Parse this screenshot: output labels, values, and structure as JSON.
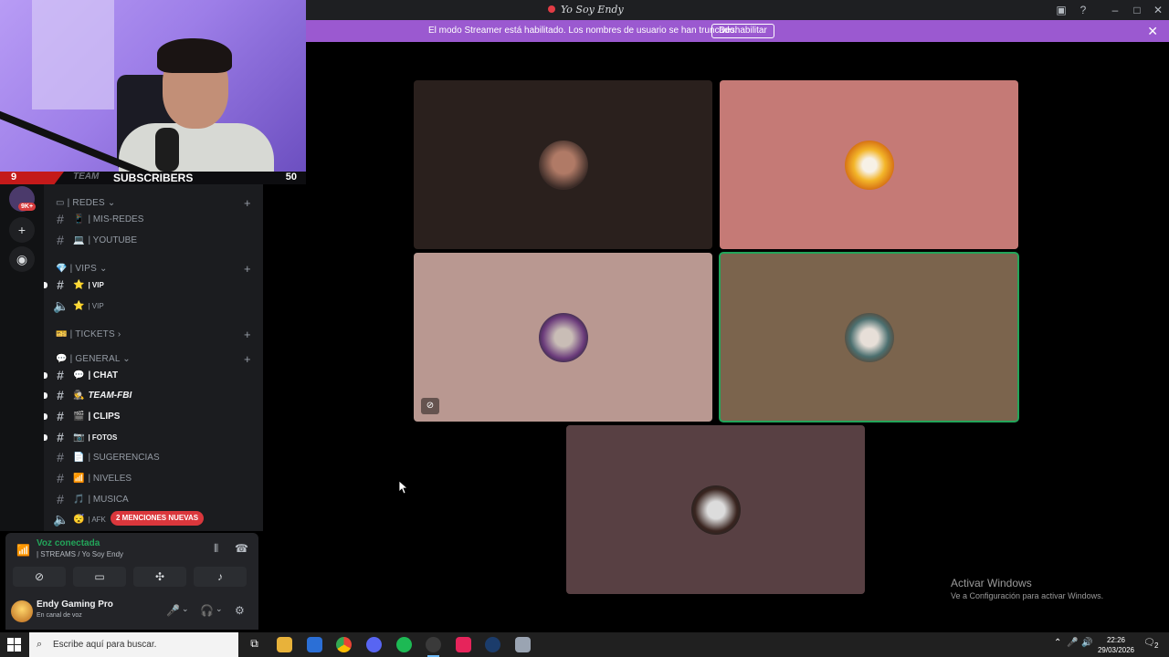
{
  "window": {
    "title": "Yo Soy Endy"
  },
  "banner": {
    "message": "El modo Streamer está habilitado. Los nombres de usuario se han truncado.",
    "button": "Deshabilitar"
  },
  "overlay": {
    "left_count": "9",
    "label": "SUBSCRIBERS",
    "right_count": "50",
    "behind_text": "TEAM"
  },
  "rail": {
    "badge": "9K+",
    "icons": [
      "server-avatar-icon",
      "add-server-icon",
      "explore-icon"
    ]
  },
  "channels": {
    "categories": [
      {
        "label": "| REDES",
        "expand": "⌄"
      },
      {
        "label": "| VIPS",
        "expand": "⌄"
      },
      {
        "label": "| TICKETS",
        "expand": "›"
      },
      {
        "label": "| GENERAL",
        "expand": "⌄"
      }
    ],
    "items": [
      {
        "label": "| MIS-REDES"
      },
      {
        "label": "| YOUTUBE"
      },
      {
        "label": "| VIP"
      },
      {
        "label": "| VIP"
      },
      {
        "label": "| CHAT"
      },
      {
        "label": "TEAM-FBI"
      },
      {
        "label": "| CLIPS"
      },
      {
        "label": "| FOTOS"
      },
      {
        "label": "| SUGERENCIAS"
      },
      {
        "label": "| NIVELES"
      },
      {
        "label": "| MUSICA"
      },
      {
        "label": "| AFK"
      }
    ],
    "mentions_pill": "2 MENCIONES NUEVAS"
  },
  "voice": {
    "status": "Voz conectada",
    "channel": "| STREAMS / Yo Soy Endy"
  },
  "user": {
    "name": "Endy Gaming Pro",
    "status": "En canal de voz"
  },
  "tiles": [
    {
      "bg": "#2a201d",
      "speaking": false
    },
    {
      "bg": "#c57a76",
      "speaking": false
    },
    {
      "bg": "#b99891",
      "speaking": false,
      "muted_video": true
    },
    {
      "bg": "#7b644d",
      "speaking": true
    },
    {
      "bg": "#584043",
      "speaking": false
    }
  ],
  "watermark": {
    "line1": "Activar Windows",
    "line2": "Ve a Configuración para activar Windows."
  },
  "taskbar": {
    "search_placeholder": "Escribe aquí para buscar.",
    "time": "22:26",
    "date": "29/03/2026",
    "notifications": "2"
  },
  "colors": {
    "accent": "#9b59d0",
    "speaking": "#23a55a",
    "danger": "#da373c"
  }
}
